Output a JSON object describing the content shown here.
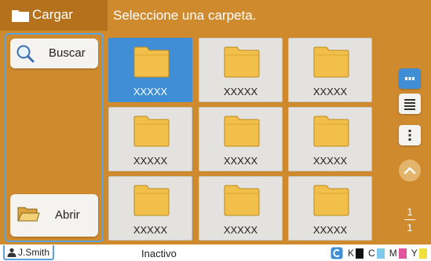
{
  "header": {
    "back_label": "Cargar",
    "message": "Seleccione una carpeta."
  },
  "sidebar": {
    "search_label": "Buscar",
    "open_label": "Abrir"
  },
  "folders": [
    {
      "name": "XXXXX",
      "selected": true
    },
    {
      "name": "XXXXX",
      "selected": false
    },
    {
      "name": "XXXXX",
      "selected": false
    },
    {
      "name": "XXXXX",
      "selected": false
    },
    {
      "name": "XXXXX",
      "selected": false
    },
    {
      "name": "XXXXX",
      "selected": false
    },
    {
      "name": "XXXXX",
      "selected": false
    },
    {
      "name": "XXXXX",
      "selected": false
    },
    {
      "name": "XXXXX",
      "selected": false
    }
  ],
  "view_controls": {
    "active_view": "thumbnail",
    "icons": [
      "thumbnail-view-icon",
      "list-view-icon",
      "more-options-icon",
      "scroll-up-icon",
      "scroll-down-icon"
    ]
  },
  "pagination": {
    "current": "1",
    "total": "1"
  },
  "footer": {
    "user": "J.Smith",
    "status": "Inactivo",
    "ink_labels": [
      "K",
      "C",
      "M",
      "Y"
    ]
  },
  "colors": {
    "header": "#b5711b",
    "panel": "#cf8a2e",
    "accent": "#3f8ed6",
    "selection_outline": "#5ba3dd",
    "ink_k": "#111111",
    "ink_c": "#7fc9ec",
    "ink_m": "#e0559b",
    "ink_y": "#f0df3a"
  }
}
